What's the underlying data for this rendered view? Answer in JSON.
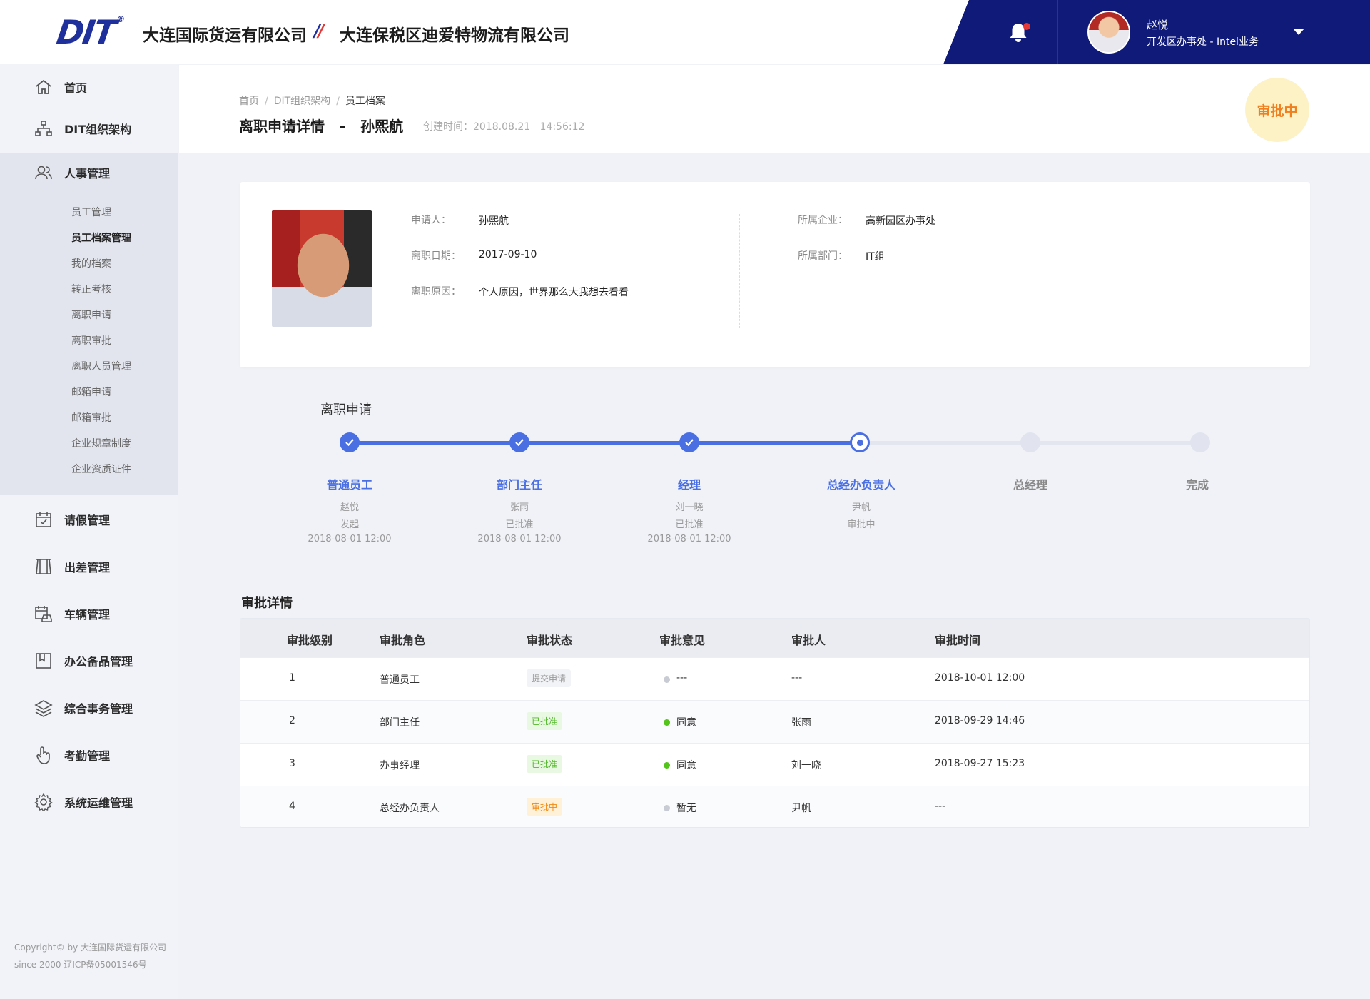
{
  "header": {
    "logo_text": "DIT",
    "logo_reg": "®",
    "company_a": "大连国际货运有限公司",
    "company_b": "大连保税区迪爱特物流有限公司",
    "user_name": "赵悦",
    "user_dept": "开发区办事处 - Intel业务"
  },
  "sidebar": {
    "items_top": [
      {
        "label": "首页",
        "icon": "home-icon"
      },
      {
        "label": "DIT组织架构",
        "icon": "org-chart-icon"
      },
      {
        "label": "人事管理",
        "icon": "users-icon"
      }
    ],
    "sub_items": [
      "员工管理",
      "员工档案管理",
      "我的档案",
      "转正考核",
      "离职申请",
      "离职审批",
      "离职人员管理",
      "邮箱申请",
      "邮箱审批",
      "企业规章制度",
      "企业资质证件"
    ],
    "items_bottom": [
      {
        "label": "请假管理",
        "icon": "calendar-icon"
      },
      {
        "label": "出差管理",
        "icon": "travel-icon"
      },
      {
        "label": "车辆管理",
        "icon": "vehicle-icon"
      },
      {
        "label": "办公备品管理",
        "icon": "bookmark-icon"
      },
      {
        "label": "综合事务管理",
        "icon": "layers-icon"
      },
      {
        "label": "考勤管理",
        "icon": "touch-icon"
      },
      {
        "label": "系统运维管理",
        "icon": "gear-icon"
      }
    ],
    "copyright_line1": "Copyright© by 大连国际货运有限公司",
    "copyright_line2": "since 2000 辽ICP备05001546号"
  },
  "page": {
    "breadcrumb": [
      "首页",
      "DIT组织架构",
      "员工档案"
    ],
    "title": "离职申请详情   -   孙熙航",
    "created": "创建时间：2018.08.21   14:56:12",
    "status": "审批中"
  },
  "applicant": {
    "labels": {
      "applicant": "申请人：",
      "date": "离职日期：",
      "reason": "离职原因：",
      "company": "所属企业：",
      "dept": "所属部门："
    },
    "values": {
      "applicant": "孙熙航",
      "date": "2017-09-10",
      "reason": "个人原因，世界那么大我想去看看",
      "company": "高新园区办事处",
      "dept": "IT组"
    }
  },
  "steps": {
    "title": "离职申请",
    "items": [
      {
        "name": "普通员工",
        "person": "赵悦",
        "status": "发起",
        "time": "2018-08-01 12:00"
      },
      {
        "name": "部门主任",
        "person": "张雨",
        "status": "已批准",
        "time": "2018-08-01 12:00"
      },
      {
        "name": "经理",
        "person": "刘一晓",
        "status": "已批准",
        "time": "2018-08-01 12:00"
      },
      {
        "name": "总经办负责人",
        "person": "尹帆",
        "status": "审批中",
        "time": ""
      },
      {
        "name": "总经理",
        "person": "",
        "status": "",
        "time": ""
      },
      {
        "name": "完成",
        "person": "",
        "status": "",
        "time": ""
      }
    ]
  },
  "approvals": {
    "title": "审批详情",
    "headers": [
      "审批级别",
      "审批角色",
      "审批状态",
      "审批意见",
      "审批人",
      "审批时间"
    ],
    "rows": [
      {
        "level": "1",
        "role": "普通员工",
        "status": "提交申请",
        "opinion": "---",
        "approver": "---",
        "time": "2018-10-01 12:00"
      },
      {
        "level": "2",
        "role": "部门主任",
        "status": "已批准",
        "opinion": "同意",
        "approver": "张雨",
        "time": "2018-09-29 14:46"
      },
      {
        "level": "3",
        "role": "办事经理",
        "status": "已批准",
        "opinion": "同意",
        "approver": "刘一晓",
        "time": "2018-09-27 15:23"
      },
      {
        "level": "4",
        "role": "总经办负责人",
        "status": "审批中",
        "opinion": "暂无",
        "approver": "尹帆",
        "time": "---"
      }
    ]
  },
  "colors": {
    "brand_dark": "#101a78",
    "accent_blue": "#4a6fe3",
    "status_orange": "#f07f1f",
    "approved_green": "#52b82a"
  }
}
